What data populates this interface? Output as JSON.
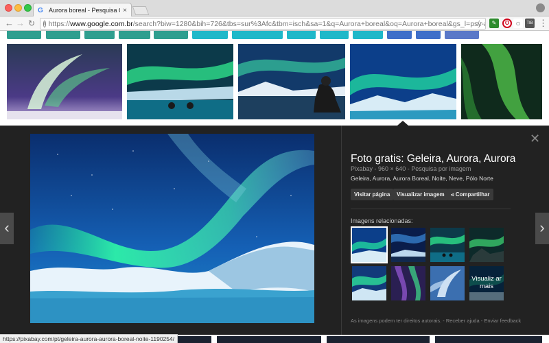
{
  "browser": {
    "tab_title": "Aurora boreal - Pesquisa Goog",
    "tab_close": "×",
    "url_scheme": "https://",
    "url_host": "www.google.com.br",
    "url_rest": "/search?biw=1280&bih=726&tbs=sur%3Afc&tbm=isch&sa=1&q=Aurora+boreal&oq=Aurora+boreal&gs_l=psy-ab.3..0l4.5...",
    "ext_badge": "TIB"
  },
  "chips": {
    "colors": [
      "#2f9e8f",
      "#2f9e8f",
      "#2f9e8f",
      "#2f9e8f",
      "#2f9e8f",
      "#1fb8c9",
      "#1fb8c9",
      "#1fb8c9",
      "#1fb8c9",
      "#1fb8c9",
      "#3f6fc9",
      "#3f6fc9",
      "#5a78c8"
    ]
  },
  "details": {
    "title": "Foto gratis: Geleira, Aurora, Aurora …",
    "meta": "Pixabay - 960 × 640 - Pesquisa por imagem",
    "tags": "Geleira, Aurora, Aurora Boreal, Noite, Neve, Pólo Norte",
    "visit_label": "Visitar página",
    "view_label": "Visualizar imagem",
    "share_label": "Compartilhar",
    "related_label": "Imagens relacionadas:",
    "more_label": "Visualiz ar mais",
    "footer_rights": "As imagens podem ter direitos autorais.",
    "footer_help": "Receber ajuda",
    "footer_feedback": "Enviar feedback"
  },
  "status_url": "https://pixabay.com/pt/geleira-aurora-aurora-boreal-noite-1190254/"
}
